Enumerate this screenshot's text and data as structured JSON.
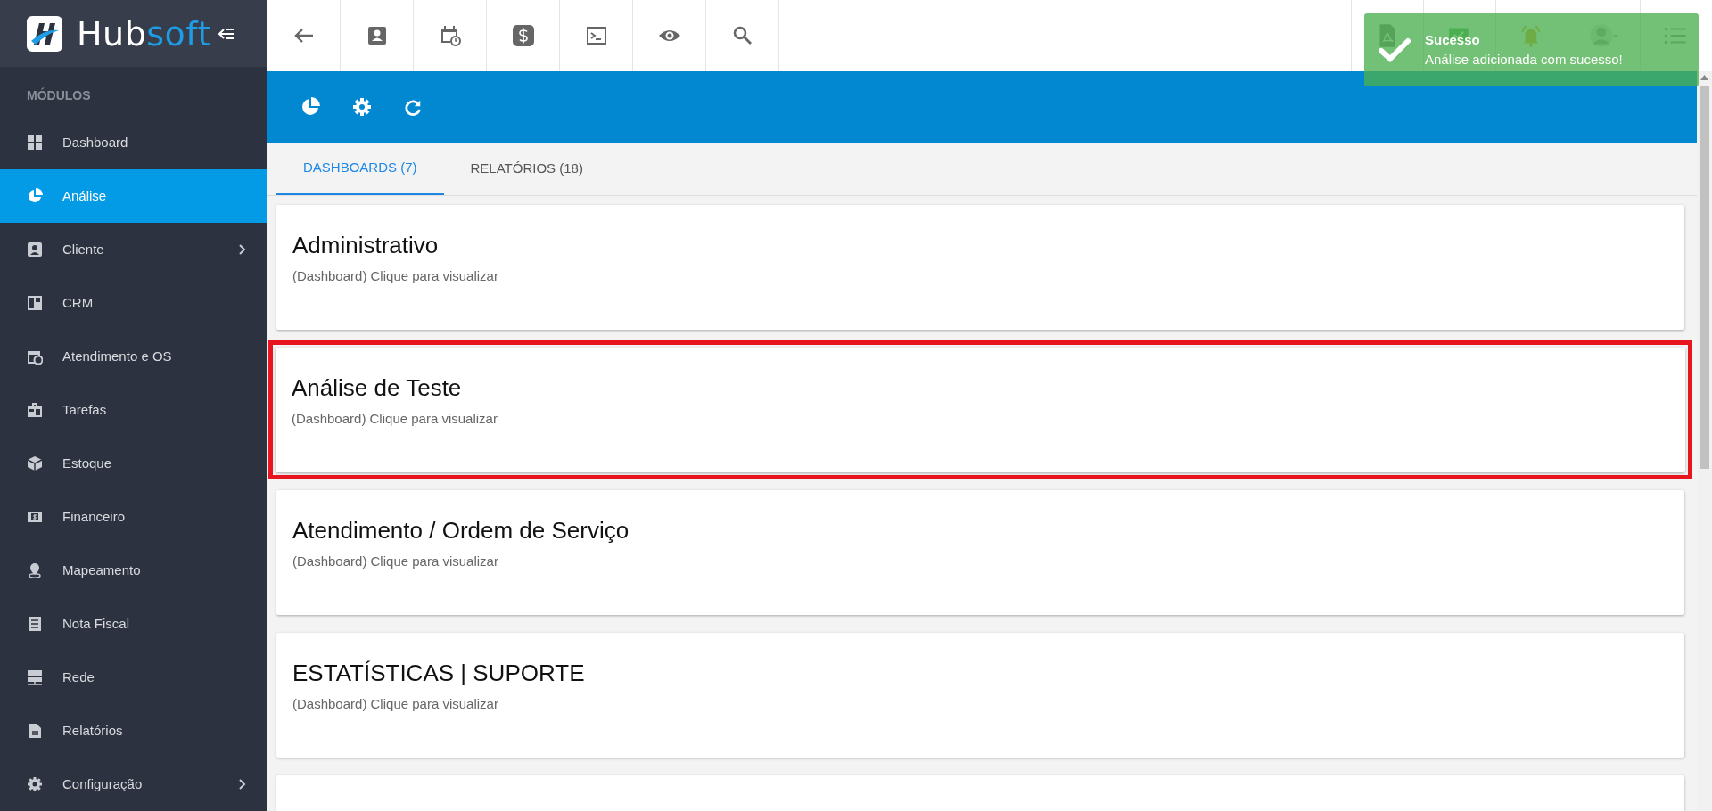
{
  "brand": {
    "name_first": "Hub",
    "name_second": "soft"
  },
  "sidebar": {
    "section_label": "MÓDULOS",
    "items": [
      {
        "label": "Dashboard",
        "selected": false,
        "has_submenu": false
      },
      {
        "label": "Análise",
        "selected": true,
        "has_submenu": false
      },
      {
        "label": "Cliente",
        "selected": false,
        "has_submenu": true
      },
      {
        "label": "CRM",
        "selected": false,
        "has_submenu": false
      },
      {
        "label": "Atendimento e OS",
        "selected": false,
        "has_submenu": false
      },
      {
        "label": "Tarefas",
        "selected": false,
        "has_submenu": false
      },
      {
        "label": "Estoque",
        "selected": false,
        "has_submenu": false
      },
      {
        "label": "Financeiro",
        "selected": false,
        "has_submenu": false
      },
      {
        "label": "Mapeamento",
        "selected": false,
        "has_submenu": false
      },
      {
        "label": "Nota Fiscal",
        "selected": false,
        "has_submenu": false
      },
      {
        "label": "Rede",
        "selected": false,
        "has_submenu": false
      },
      {
        "label": "Relatórios",
        "selected": false,
        "has_submenu": false
      },
      {
        "label": "Configuração",
        "selected": false,
        "has_submenu": true
      }
    ]
  },
  "toast": {
    "title": "Sucesso",
    "message": "Análise adicionada com sucesso!"
  },
  "tabs": [
    {
      "label": "DASHBOARDS (7)",
      "selected": true
    },
    {
      "label": "RELATÓRIOS (18)",
      "selected": false
    }
  ],
  "cards": [
    {
      "title": "Administrativo",
      "subtitle": "(Dashboard) Clique para visualizar",
      "highlighted": false
    },
    {
      "title": "Análise de Teste",
      "subtitle": "(Dashboard) Clique para visualizar",
      "highlighted": true
    },
    {
      "title": "Atendimento / Ordem de Serviço",
      "subtitle": "(Dashboard) Clique para visualizar",
      "highlighted": false
    },
    {
      "title": "ESTATÍSTICAS | SUPORTE",
      "subtitle": "(Dashboard) Clique para visualizar",
      "highlighted": false
    }
  ]
}
